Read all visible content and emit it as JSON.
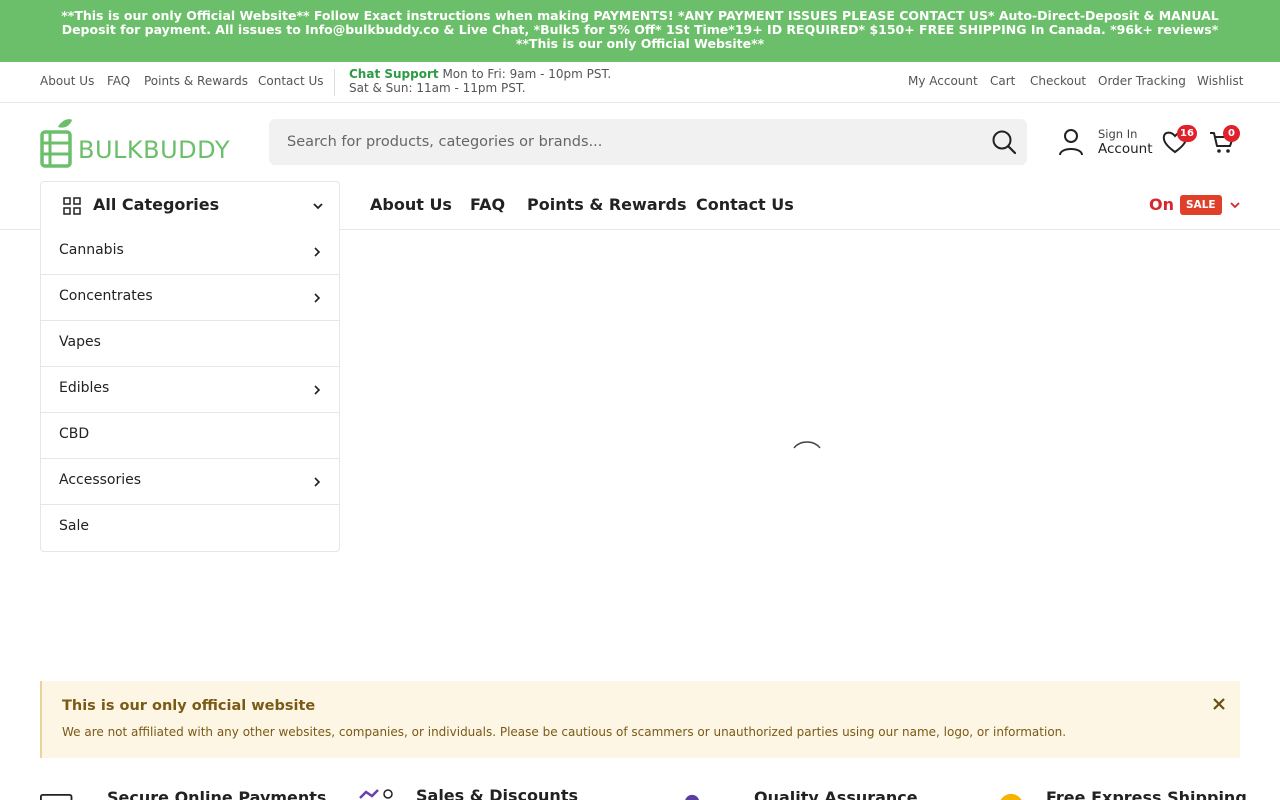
{
  "announcement": "**This is our only Official Website** Follow Exact instructions when making PAYMENTS! *ANY PAYMENT ISSUES PLEASE CONTACT US* Auto-Direct-Deposit & MANUAL Deposit for payment. All issues to Info@bulkbuddy.co & Live Chat, *Bulk5 for 5% Off* 1St Time*19+ ID REQUIRED* $150+ FREE SHIPPING In Canada. *96k+ reviews* **This is our only Official Website**",
  "topbar": {
    "links": [
      "About Us",
      "FAQ",
      "Points & Rewards",
      "Contact Us"
    ],
    "chat_label": "Chat Support",
    "chat_hours_1": "Mon to Fri: 9am - 10pm PST.",
    "chat_hours_2": "Sat & Sun: 11am - 11pm PST.",
    "right_links": [
      "My Account",
      "Cart",
      "Checkout",
      "Order Tracking",
      "Wishlist"
    ]
  },
  "header": {
    "logo_text": "BULKBUDDY",
    "search_placeholder": "Search for products, categories or brands...",
    "account_small": "Sign In",
    "account_big": "Account",
    "wishlist_count": "16",
    "cart_count": "0"
  },
  "categories": {
    "title": "All Categories",
    "items": [
      {
        "label": "Cannabis",
        "has_sub": true
      },
      {
        "label": "Concentrates",
        "has_sub": true
      },
      {
        "label": "Vapes",
        "has_sub": false
      },
      {
        "label": "Edibles",
        "has_sub": true
      },
      {
        "label": "CBD",
        "has_sub": false
      },
      {
        "label": "Accessories",
        "has_sub": true
      },
      {
        "label": "Sale",
        "has_sub": false
      }
    ]
  },
  "mainnav": [
    "About Us",
    "FAQ",
    "Points & Rewards",
    "Contact Us"
  ],
  "sale": {
    "on": "On",
    "tag": "SALE"
  },
  "notice": {
    "title": "This is our only official website",
    "body": "We are not affiliated with any other websites, companies, or individuals. Please be cautious of scammers or unauthorized parties using our name, logo, or information."
  },
  "features": [
    "Secure Online Payments",
    "Sales & Discounts",
    "Quality Assurance",
    "Free Express Shipping"
  ],
  "colors": {
    "brand_green": "#6cbf6a",
    "sale_red": "#d8262a",
    "badge_red": "#e0202a"
  }
}
